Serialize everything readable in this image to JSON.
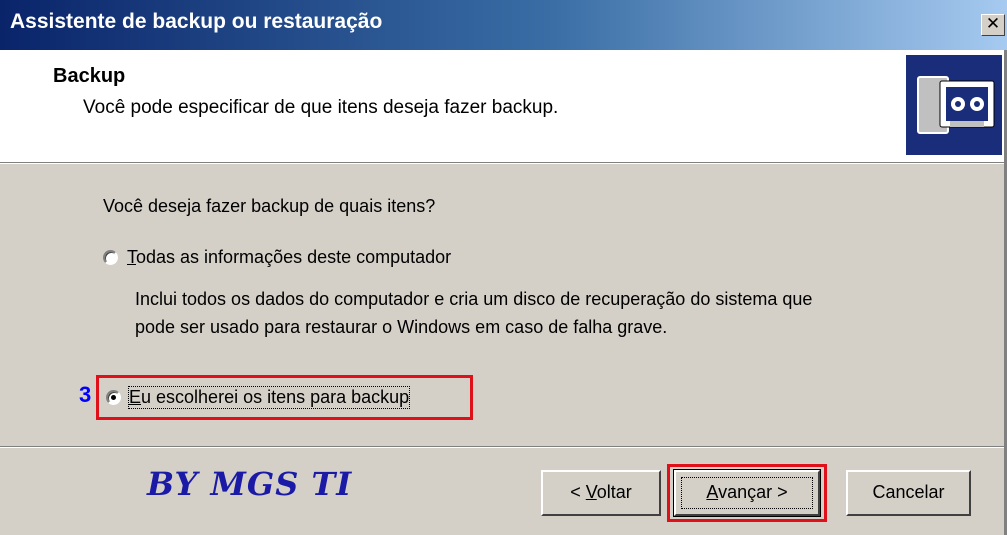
{
  "window": {
    "title": "Assistente de backup ou restauração",
    "close_glyph": "✕"
  },
  "header": {
    "title": "Backup",
    "subtitle": "Você pode especificar de que itens deseja fazer backup.",
    "icon": "backup-tapes-icon"
  },
  "body": {
    "question": "Você deseja fazer backup de quais itens?",
    "options": [
      {
        "mnemonic": "T",
        "label_rest": "odas as informações deste computador",
        "description_lines": [
          "Inclui todos os dados do computador e cria um disco de recuperação do sistema que",
          "pode ser usado para restaurar o Windows em caso de falha grave."
        ],
        "checked": false
      },
      {
        "mnemonic": "E",
        "label_rest": "u escolherei os itens para backup",
        "checked": true
      }
    ],
    "step_number": "3"
  },
  "annotations": {
    "highlight_color": "#e0101b",
    "step_color": "#0000ff"
  },
  "footer": {
    "watermark": "BY MGS TI",
    "buttons": {
      "back": {
        "prefix": "< ",
        "mnemonic": "V",
        "rest": "oltar"
      },
      "next": {
        "mnemonic": "A",
        "rest": "vançar >"
      },
      "cancel": {
        "label": "Cancelar"
      }
    }
  }
}
